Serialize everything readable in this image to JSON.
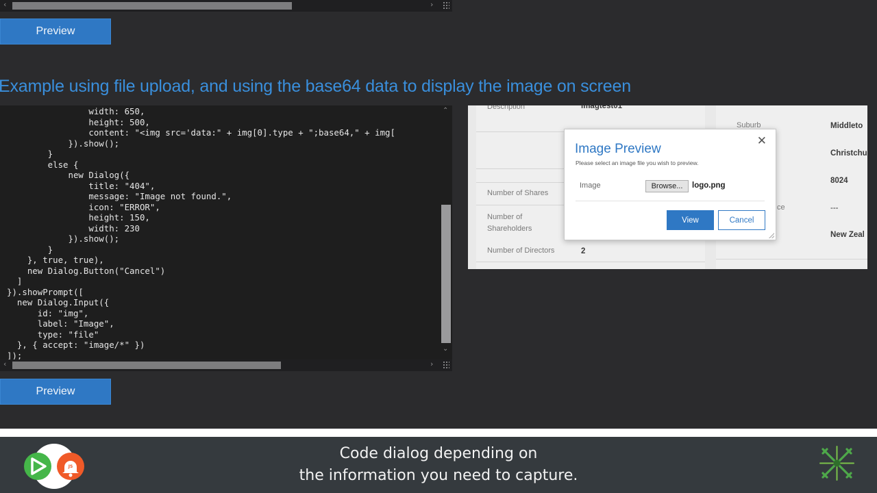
{
  "top_scrollbar": {
    "left_arrow": "‹",
    "right_arrow": "›"
  },
  "preview_top": {
    "label": "Preview"
  },
  "heading": "Example using file upload, and using the base64 data to display the image on screen",
  "code_lines": [
    "                width: 650,",
    "                height: 500,",
    "                content: \"<img src='data:\" + img[0].type + \";base64,\" + img[",
    "            }).show();",
    "        }",
    "        else {",
    "            new Dialog({",
    "                title: \"404\",",
    "                message: \"Image not found.\",",
    "                icon: \"ERROR\",",
    "                height: 150,",
    "                width: 230",
    "            }).show();",
    "        }",
    "    }, true, true),",
    "    new Dialog.Button(\"Cancel\")",
    "  ]",
    "}).showPrompt([",
    "  new Dialog.Input({",
    "      id: \"img\",",
    "      label: \"Image\",",
    "      type: \"file\"",
    "  }, { accept: \"image/*\" })",
    "]);"
  ],
  "code_scrollbar": {
    "up": "⌃",
    "down": "⌄",
    "left_arrow": "‹",
    "right_arrow": "›"
  },
  "form": {
    "description_label": "Description",
    "description_value": "imagtest01",
    "shares_label": "Number of Shares",
    "shareholders_label": "Number of Shareholders",
    "directors_label": "Number of Directors",
    "directors_value": "2",
    "suburb_label": "Suburb",
    "suburb_value": "Middleto",
    "city_value": "Christchu",
    "postcode_value": "8024",
    "province_label_fragment": "ce",
    "province_value": "---",
    "country_value": "New Zeal"
  },
  "dialog": {
    "title": "Image Preview",
    "message": "Please select an image file you wish to preview.",
    "close_glyph": "✕",
    "image_label": "Image",
    "browse_label": "Browse...",
    "file_name": "logo.png",
    "view_label": "View",
    "cancel_label": "Cancel"
  },
  "preview_bottom": {
    "label": "Preview"
  },
  "caption": {
    "line1": "Code dialog depending on",
    "line2": "the information you need to capture."
  },
  "logo_left_badge": "JS",
  "icons": {
    "left_logo": "dataverse-js-notification-logo",
    "right_logo": "asterisk-x-logo"
  },
  "colors": {
    "accent_blue": "#2f78c4",
    "heading_blue": "#3a8fdc",
    "page_bg": "#2b2b2d",
    "code_bg": "#1e1e1e",
    "bottom_bar": "#353a3e",
    "logo_green": "#45b649",
    "logo_orange": "#f05a28"
  }
}
